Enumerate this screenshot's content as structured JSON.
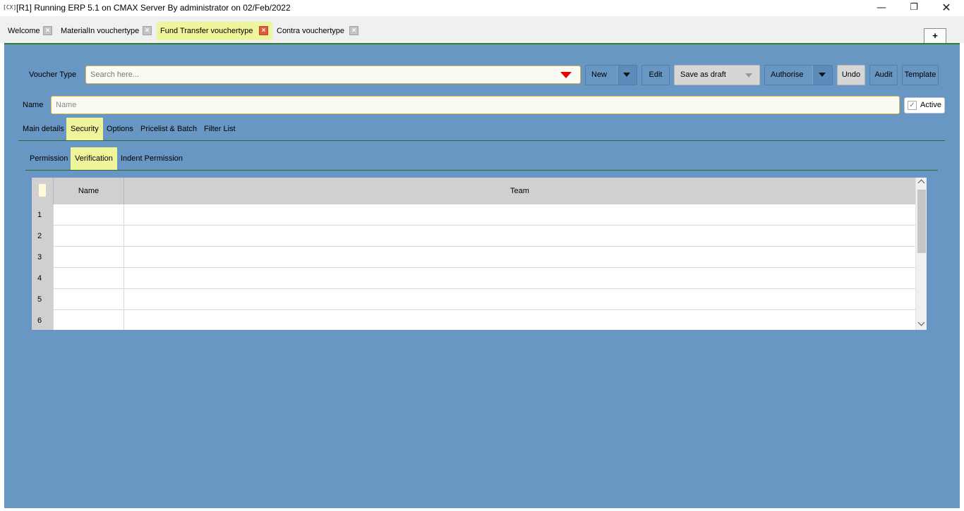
{
  "window": {
    "icon_text": "[CX]",
    "title": "[R1] Running ERP 5.1 on CMAX Server By administrator on 02/Feb/2022",
    "min_glyph": "—",
    "max_glyph": "❐",
    "close_glyph": "✕"
  },
  "doc_tabs": [
    {
      "label": "Welcome"
    },
    {
      "label": "MaterialIn vouchertype"
    },
    {
      "label": "Fund Transfer vouchertype"
    },
    {
      "label": "Contra vouchertype"
    }
  ],
  "tab_close_glyph": "×",
  "add_tab_label": "+",
  "form": {
    "voucher_type_label": "Voucher Type",
    "search_placeholder": "Search here...",
    "name_label": "Name",
    "name_placeholder": "Name",
    "active_label": "Active",
    "active_checked": true,
    "check_glyph": "✓"
  },
  "toolbar": {
    "new_label": "New",
    "edit_label": "Edit",
    "save_draft_label": "Save as draft",
    "authorise_label": "Authorise",
    "undo_label": "Undo",
    "audit_label": "Audit",
    "template_label": "Template"
  },
  "section_tabs": [
    {
      "label": "Main details"
    },
    {
      "label": "Security"
    },
    {
      "label": "Options"
    },
    {
      "label": "Pricelist & Batch"
    },
    {
      "label": "Filter List"
    }
  ],
  "security_tabs": [
    {
      "label": "Permission"
    },
    {
      "label": "Verification"
    },
    {
      "label": "Indent Permission"
    }
  ],
  "grid": {
    "columns": [
      "Name",
      "Team"
    ],
    "rows": [
      {
        "num": "1",
        "name": "",
        "team": ""
      },
      {
        "num": "2",
        "name": "",
        "team": ""
      },
      {
        "num": "3",
        "name": "",
        "team": ""
      },
      {
        "num": "4",
        "name": "",
        "team": ""
      },
      {
        "num": "5",
        "name": "",
        "team": ""
      },
      {
        "num": "6",
        "name": "",
        "team": ""
      }
    ]
  },
  "colors": {
    "workspace": "#6997c3",
    "active_tab": "#eff59a",
    "accent_line": "#2e7d32",
    "input_border": "#e4b64a",
    "dropdown_caret": "#ee0000"
  }
}
